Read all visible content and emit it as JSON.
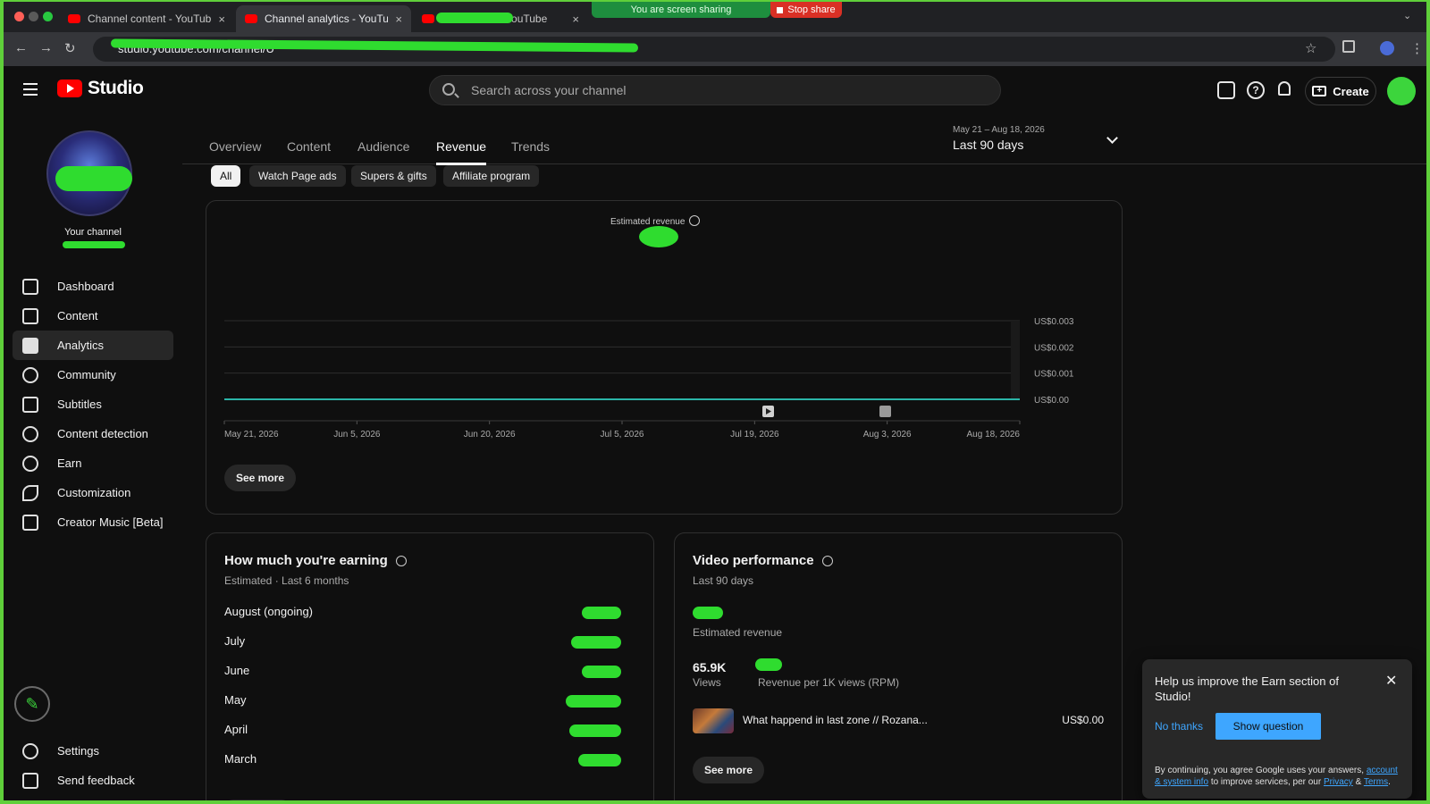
{
  "browser": {
    "tabs": [
      {
        "title": "Channel content - YouTube Studio",
        "active": false
      },
      {
        "title": "Channel analytics - YouTube Studio",
        "active": true
      },
      {
        "title": "- YouTube",
        "active": false
      }
    ],
    "sharing_text": "You are screen sharing",
    "stop_share_label": "Stop share",
    "url": "studio.youtube.com/channel/U"
  },
  "header": {
    "logo_text": "Studio",
    "search_placeholder": "Search across your channel",
    "help_icon": "?",
    "create_label": "Create"
  },
  "sidebar": {
    "your_channel_label": "Your channel",
    "items": [
      {
        "label": "Dashboard",
        "icon": "dashboard-icon"
      },
      {
        "label": "Content",
        "icon": "content-icon"
      },
      {
        "label": "Analytics",
        "icon": "analytics-icon",
        "active": true
      },
      {
        "label": "Community",
        "icon": "community-icon"
      },
      {
        "label": "Subtitles",
        "icon": "subtitles-icon"
      },
      {
        "label": "Content detection",
        "icon": "content-detection-icon"
      },
      {
        "label": "Earn",
        "icon": "earn-icon"
      },
      {
        "label": "Customization",
        "icon": "customization-icon"
      },
      {
        "label": "Creator Music [Beta]",
        "icon": "creator-music-icon"
      }
    ],
    "bottom_items": [
      {
        "label": "Settings",
        "icon": "settings-icon"
      },
      {
        "label": "Send feedback",
        "icon": "feedback-icon"
      }
    ]
  },
  "analytics": {
    "tabs": [
      "Overview",
      "Content",
      "Audience",
      "Revenue",
      "Trends"
    ],
    "active_tab": "Revenue",
    "date_range": "May 21 – Aug 18, 2026",
    "date_preset": "Last 90 days",
    "chips": [
      "All",
      "Watch Page ads",
      "Supers & gifts",
      "Affiliate program"
    ],
    "active_chip": "All"
  },
  "chart_data": {
    "type": "line",
    "title": "Estimated revenue",
    "x_tick_labels": [
      "May 21, 2026",
      "Jun 5, 2026",
      "Jun 20, 2026",
      "Jul 5, 2026",
      "Jul 19, 2026",
      "Aug 3, 2026",
      "Aug 18, 2026"
    ],
    "y_tick_labels": [
      "US$0.003",
      "US$0.002",
      "US$0.001",
      "US$0.00"
    ],
    "ylim": [
      0,
      0.003
    ],
    "series": [
      {
        "values": [
          0,
          0,
          0,
          0,
          0,
          0,
          0
        ]
      }
    ],
    "color": "#2bb5a8",
    "see_more_label": "See more"
  },
  "earning": {
    "title": "How much you're earning",
    "subtitle": "Estimated · Last 6 months",
    "months": [
      "August (ongoing)",
      "July",
      "June",
      "May",
      "April",
      "March"
    ]
  },
  "video_performance": {
    "title": "Video performance",
    "subtitle": "Last 90 days",
    "estimated_revenue_label": "Estimated revenue",
    "views_value": "65.9K",
    "views_label": "Views",
    "rpm_label": "Revenue per 1K views (RPM)",
    "top_video_title": "What happend in last zone // Rozana...",
    "top_video_revenue": "US$0.00",
    "see_more_label": "See more"
  },
  "popup": {
    "title": "Help us improve the Earn section of Studio!",
    "no_thanks": "No thanks",
    "show_question": "Show question",
    "fine_print_1": "By continuing, you agree Google uses your answers,",
    "fine_link_1": "account & system info",
    "fine_print_2": "to improve services, per our",
    "fine_link_2": "Privacy",
    "fine_amp": "&",
    "fine_link_3": "Terms",
    "fine_end": "."
  },
  "colors": {
    "accent_blue": "#3ea6ff",
    "youtube_red": "#ff0000",
    "chart_line": "#2bb5a8",
    "redaction_green": "#2fdc2f"
  }
}
